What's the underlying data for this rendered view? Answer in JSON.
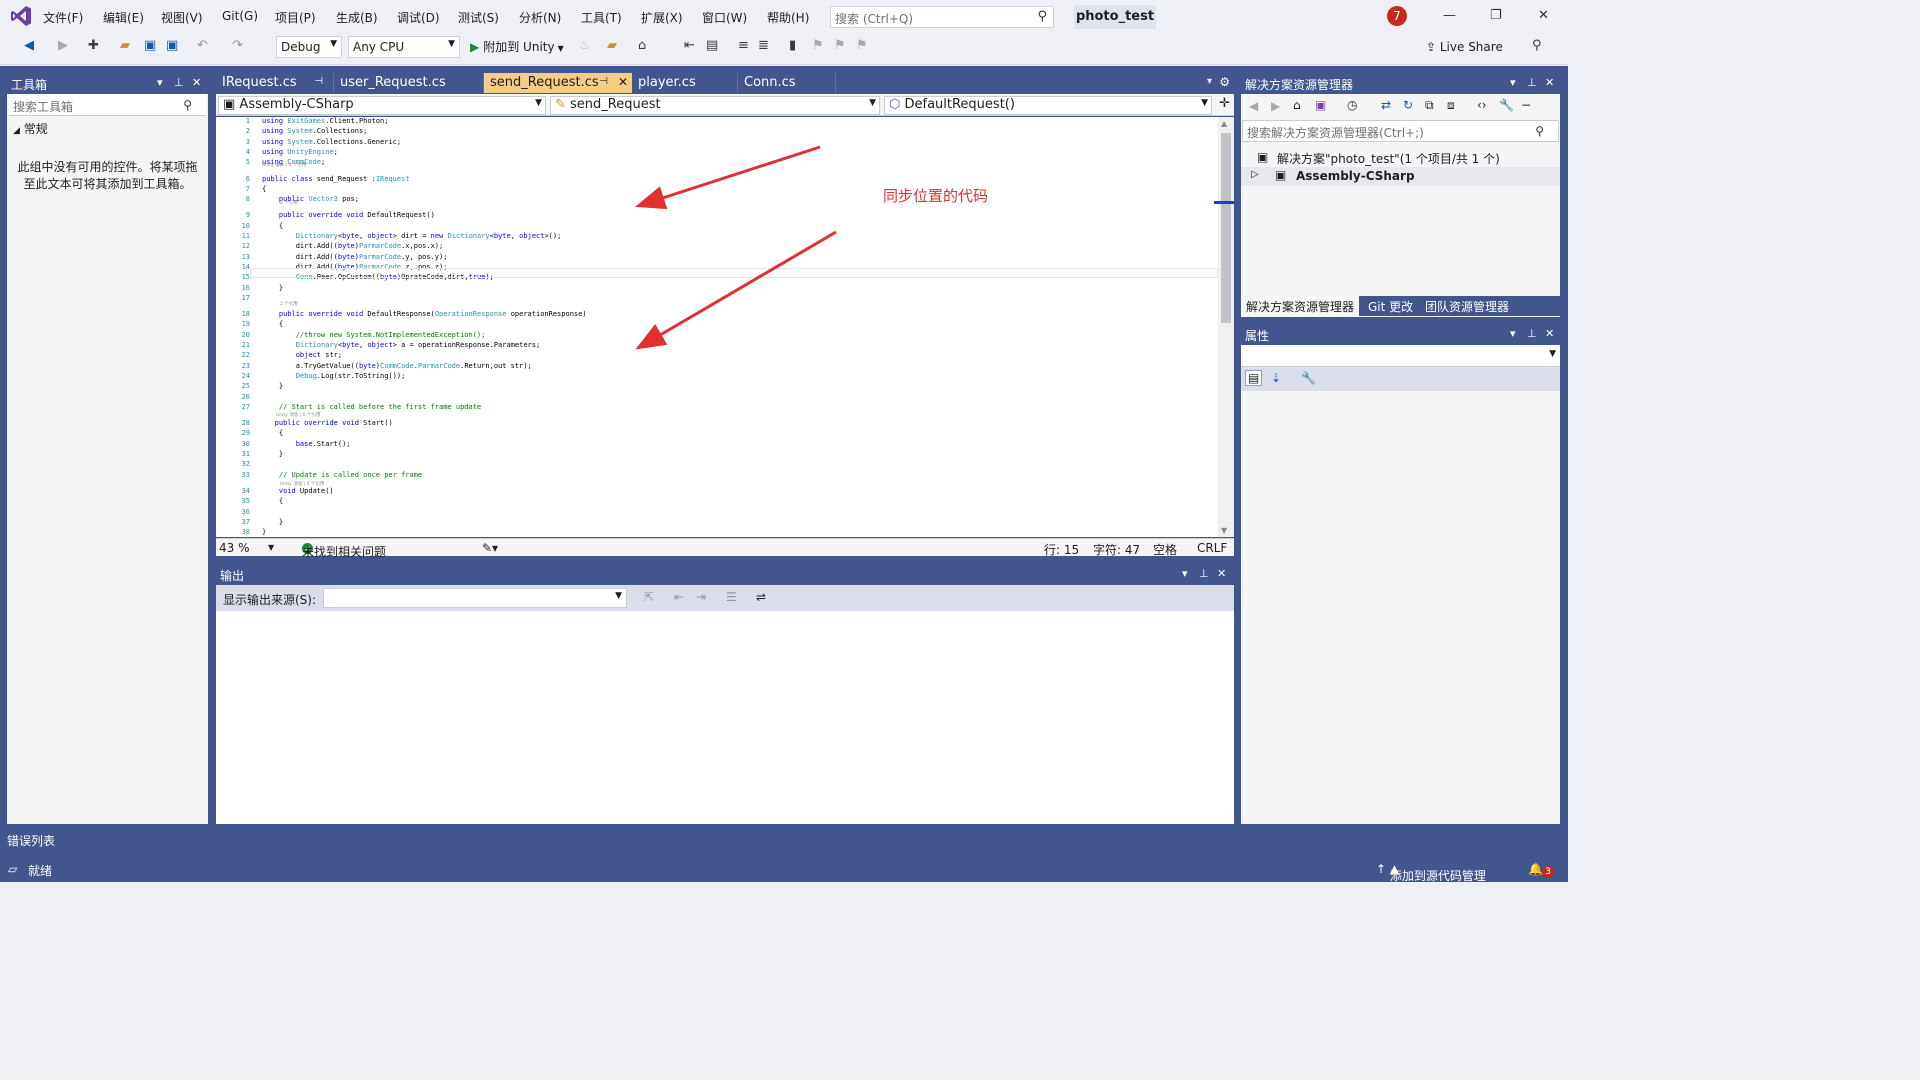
{
  "menu": {
    "items": [
      "文件(F)",
      "编辑(E)",
      "视图(V)",
      "Git(G)",
      "项目(P)",
      "生成(B)",
      "调试(D)",
      "测试(S)",
      "分析(N)",
      "工具(T)",
      "扩展(X)",
      "窗口(W)",
      "帮助(H)"
    ],
    "search_placeholder": "搜索 (Ctrl+Q)",
    "project_name": "photo_test",
    "notification_count": "7"
  },
  "toolbar": {
    "config": "Debug",
    "platform": "Any CPU",
    "run_label": "附加到 Unity",
    "live_share": "Live Share"
  },
  "toolbox": {
    "title": "工具箱",
    "search_placeholder": "搜索工具箱",
    "group": "常规",
    "empty_text": "此组中没有可用的控件。将某项拖至此文本可将其添加到工具箱。"
  },
  "editor": {
    "tabs": [
      {
        "label": "IRequest.cs",
        "active": false
      },
      {
        "label": "user_Request.cs",
        "active": false
      },
      {
        "label": "send_Request.cs",
        "active": true
      },
      {
        "label": "player.cs",
        "active": false
      },
      {
        "label": "Conn.cs",
        "active": false
      }
    ],
    "nav_project": "Assembly-CSharp",
    "nav_class": "send_Request",
    "nav_member": "DefaultRequest()",
    "annotation": "同步位置的代码",
    "zoom": "43 %",
    "issues": "未找到相关问题",
    "line": "行: 15",
    "char": "字符: 47",
    "spacing": "空格",
    "line_ending": "CRLF"
  },
  "code_lines": [
    {
      "n": "1",
      "text": "using ExitGames.Client.Photon;"
    },
    {
      "n": "2",
      "text": "using System.Collections;"
    },
    {
      "n": "3",
      "text": "using System.Collections.Generic;"
    },
    {
      "n": "4",
      "text": "using UnityEngine;"
    },
    {
      "n": "5",
      "text": "using CommCode;"
    },
    {
      "n": "6",
      "text": "public class send_Request :IRequest"
    },
    {
      "n": "7",
      "text": "{"
    },
    {
      "n": "8",
      "text": "    public Vector3 pos;"
    },
    {
      "n": "9",
      "text": "    public override void DefaultRequest()"
    },
    {
      "n": "10",
      "text": "    {"
    },
    {
      "n": "11",
      "text": "        Dictionary<byte, object> dirt = new Dictionary<byte, object>();"
    },
    {
      "n": "12",
      "text": "        dirt.Add((byte)ParmarCode.x,pos.x);"
    },
    {
      "n": "13",
      "text": "        dirt.Add((byte)ParmarCode.y, pos.y);"
    },
    {
      "n": "14",
      "text": "        dirt.Add((byte)ParmarCode.z, pos.z);"
    },
    {
      "n": "15",
      "text": "        Conn.Peer.OpCustom((byte)OprateCode,dirt,true);"
    },
    {
      "n": "16",
      "text": "    }"
    },
    {
      "n": "17",
      "text": ""
    },
    {
      "n": "18",
      "text": "    public override void DefaultResponse(OperationResponse operationResponse)"
    },
    {
      "n": "19",
      "text": "    {"
    },
    {
      "n": "20",
      "text": "        //throw new System.NotImplementedException();"
    },
    {
      "n": "21",
      "text": "        Dictionary<byte, object> a = operationResponse.Parameters;"
    },
    {
      "n": "22",
      "text": "        object str;"
    },
    {
      "n": "23",
      "text": "        a.TryGetValue((byte)CommCode.ParmarCode.Return,out str);"
    },
    {
      "n": "24",
      "text": "        Debug.Log(str.ToString());"
    },
    {
      "n": "25",
      "text": "    }"
    },
    {
      "n": "26",
      "text": ""
    },
    {
      "n": "27",
      "text": "    // Start is called before the first frame update"
    },
    {
      "n": "28",
      "text": "   public override void Start()"
    },
    {
      "n": "29",
      "text": "    {"
    },
    {
      "n": "30",
      "text": "        base.Start();"
    },
    {
      "n": "31",
      "text": "    }"
    },
    {
      "n": "32",
      "text": ""
    },
    {
      "n": "33",
      "text": "    // Update is called once per frame"
    },
    {
      "n": "34",
      "text": "    void Update()"
    },
    {
      "n": "35",
      "text": "    {"
    },
    {
      "n": "36",
      "text": ""
    },
    {
      "n": "37",
      "text": "    }"
    },
    {
      "n": "38",
      "text": "}"
    }
  ],
  "output": {
    "title": "输出",
    "source_label": "显示输出来源(S):"
  },
  "solution_explorer": {
    "title": "解决方案资源管理器",
    "search_placeholder": "搜索解决方案资源管理器(Ctrl+;)",
    "solution_node": "解决方案\"photo_test\"(1 个项目/共 1 个)",
    "project_node": "Assembly-CSharp",
    "tabs": [
      "解决方案资源管理器",
      "Git 更改",
      "团队资源管理器"
    ]
  },
  "properties": {
    "title": "属性"
  },
  "bottom": {
    "error_list": "错误列表",
    "status": "就绪",
    "source_control": "添加到源代码管理",
    "notif_count": "3"
  },
  "colors": {
    "frame": "#40568d",
    "active_tab": "#f5cc84",
    "annotation": "#e03030"
  }
}
